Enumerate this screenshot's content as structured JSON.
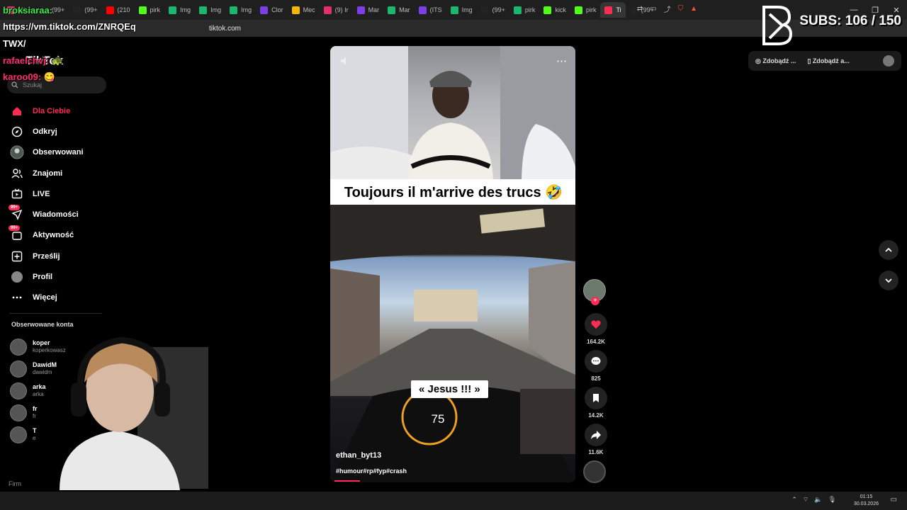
{
  "browser": {
    "tabs": [
      {
        "label": "(9) Ir",
        "color": "#e1306c"
      },
      {
        "label": "(99+",
        "color": "#222"
      },
      {
        "label": "(99+",
        "color": "#222"
      },
      {
        "label": "(210",
        "color": "#ff0000"
      },
      {
        "label": "pirk",
        "color": "#53fc18"
      },
      {
        "label": "Img",
        "color": "#1bb76e"
      },
      {
        "label": "Img",
        "color": "#1bb76e"
      },
      {
        "label": "Img",
        "color": "#1bb76e"
      },
      {
        "label": "Clor",
        "color": "#7b3fe4"
      },
      {
        "label": "Mec",
        "color": "#f7b500"
      },
      {
        "label": "(9) Ir",
        "color": "#e1306c"
      },
      {
        "label": "Mar",
        "color": "#7b3fe4"
      },
      {
        "label": "Mar",
        "color": "#1bb76e"
      },
      {
        "label": "(ITS",
        "color": "#7b3fe4"
      },
      {
        "label": "Img",
        "color": "#1bb76e"
      },
      {
        "label": "(99+",
        "color": "#222"
      },
      {
        "label": "pirk",
        "color": "#1bb76e"
      },
      {
        "label": "kick",
        "color": "#53fc18"
      },
      {
        "label": "pirk",
        "color": "#53fc18"
      },
      {
        "label": "Ti",
        "color": "#fe2c55"
      },
      {
        "label": "(99+",
        "color": "#222"
      }
    ],
    "window_controls": [
      "—",
      "❐",
      "✕"
    ],
    "address": "tiktok.com"
  },
  "overlay": {
    "url_text": "https://vm.tiktok.com/ZNRQEq",
    "url_text_2": "TWX/",
    "chat": [
      {
        "name": "broksiaraa:",
        "msg": "",
        "color": "green"
      },
      {
        "name": "rafaelchvj:",
        "msg": "",
        "color": "pink"
      },
      {
        "name": "karoo09:",
        "msg": "",
        "color": "pink"
      }
    ],
    "subs": "SUBS: 106 / 150"
  },
  "sidebar": {
    "logo": "TikTok",
    "search_placeholder": "Szukaj",
    "nav": [
      {
        "label": "Dla Ciebie",
        "icon": "home-icon",
        "active": true
      },
      {
        "label": "Odkryj",
        "icon": "compass-icon"
      },
      {
        "label": "Obserwowani",
        "icon": "following-avatar-icon"
      },
      {
        "label": "Znajomi",
        "icon": "friends-icon"
      },
      {
        "label": "LIVE",
        "icon": "live-icon"
      },
      {
        "label": "Wiadomości",
        "icon": "messages-icon",
        "badge": "99+"
      },
      {
        "label": "Aktywność",
        "icon": "activity-icon",
        "badge": "99+"
      },
      {
        "label": "Prześlij",
        "icon": "upload-icon"
      },
      {
        "label": "Profil",
        "icon": "profile-icon"
      },
      {
        "label": "Więcej",
        "icon": "more-icon"
      }
    ],
    "following_title": "Obserwowane konta",
    "following": [
      {
        "name": "koper",
        "handle": "koperkowasz"
      },
      {
        "name": "DawidM",
        "handle": "dawidm"
      },
      {
        "name": "arka",
        "handle": "arka"
      },
      {
        "name": "fr",
        "handle": "fr"
      },
      {
        "name": "T",
        "handle": "e"
      }
    ],
    "footer": "Firm"
  },
  "video": {
    "caption": "Toujours il m'arrive des trucs 🤣",
    "subtitle": "« Jesus !!! »",
    "speed": "75",
    "username": "ethan_byt13",
    "tags": "#humour#rp#fyp#crash"
  },
  "actions": {
    "likes": "164.2K",
    "comments": "825",
    "saves": "14.2K",
    "shares": "11.6K"
  },
  "topright": {
    "btn1": "Zdobądź ...",
    "btn2": "Zdobądź a..."
  },
  "taskbar": {
    "time": "01:15",
    "date": "30.03.2026"
  }
}
